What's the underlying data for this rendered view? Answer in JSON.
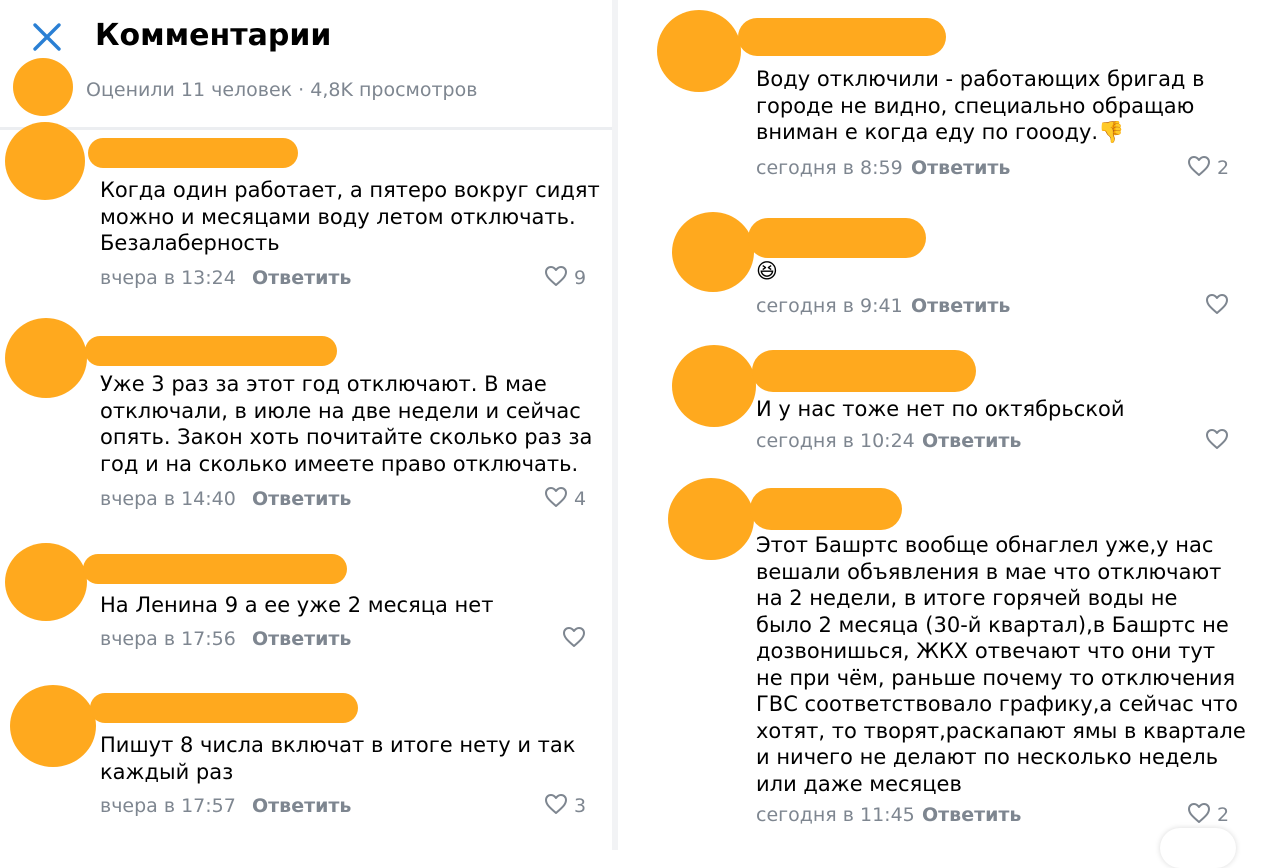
{
  "header": {
    "close_icon": "close-icon",
    "title": "Комментарии",
    "stats": "Оценили 11 человек · 4,8K просмотров"
  },
  "colors": {
    "redaction": "#FFA91E",
    "accent": "#2A7FD4",
    "muted": "#7E8690"
  },
  "left_comments": [
    {
      "text": "Когда один работает, а пятеро вокруг сидят\nможно и месяцами воду летом отключать.\nБезалаберность",
      "time": "вчера в 13:24",
      "reply": "Ответить",
      "likes": "9"
    },
    {
      "text": "Уже 3 раз за этот год отключают. В мае\nотключали, в июле на две недели и сейчас\nопять. Закон хоть почитайте сколько раз за\nгод и на сколько имеете право отключать.",
      "time": "вчера в 14:40",
      "reply": "Ответить",
      "likes": "4"
    },
    {
      "text": "На Ленина 9 а ее уже 2 месяца нет",
      "time": "вчера в 17:56",
      "reply": "Ответить",
      "likes": ""
    },
    {
      "text": "Пишут 8 числа включат в итоге нету и так\nкаждый раз",
      "time": "вчера в 17:57",
      "reply": "Ответить",
      "likes": "3"
    }
  ],
  "right_comments": [
    {
      "text": "Воду отключили - работающих бригад в\nгороде не видно, специально обращаю\nвниман е когда еду по гоооду.",
      "emoji": "👎",
      "emoji_name": "thumbs-down-emoji",
      "time": "сегодня в 8:59",
      "reply": "Ответить",
      "likes": "2"
    },
    {
      "text": "",
      "emoji": "😆",
      "emoji_name": "laughing-emoji",
      "time": "сегодня в 9:41",
      "reply": "Ответить",
      "likes": ""
    },
    {
      "text": "И у нас тоже нет по октябрьской",
      "time": "сегодня в 10:24",
      "reply": "Ответить",
      "likes": ""
    },
    {
      "text": "Этот Башртс вообще обнаглел уже,у нас\nвешали объявления в мае что отключают\nна 2 недели, в итоге горячей воды не\nбыло 2 месяца (30-й квартал),в Башртс не\nдозвонишься, ЖКХ отвечают что они тут\nне при чём, раньше почему то отключения\nГВС соответствовало графику,а сейчас что\nхотят, то творят,раскапают ямы в квартале\nи ничего не делают по несколько недель\nили даже месяцев",
      "time": "сегодня в 11:45",
      "reply": "Ответить",
      "likes": "2"
    }
  ]
}
